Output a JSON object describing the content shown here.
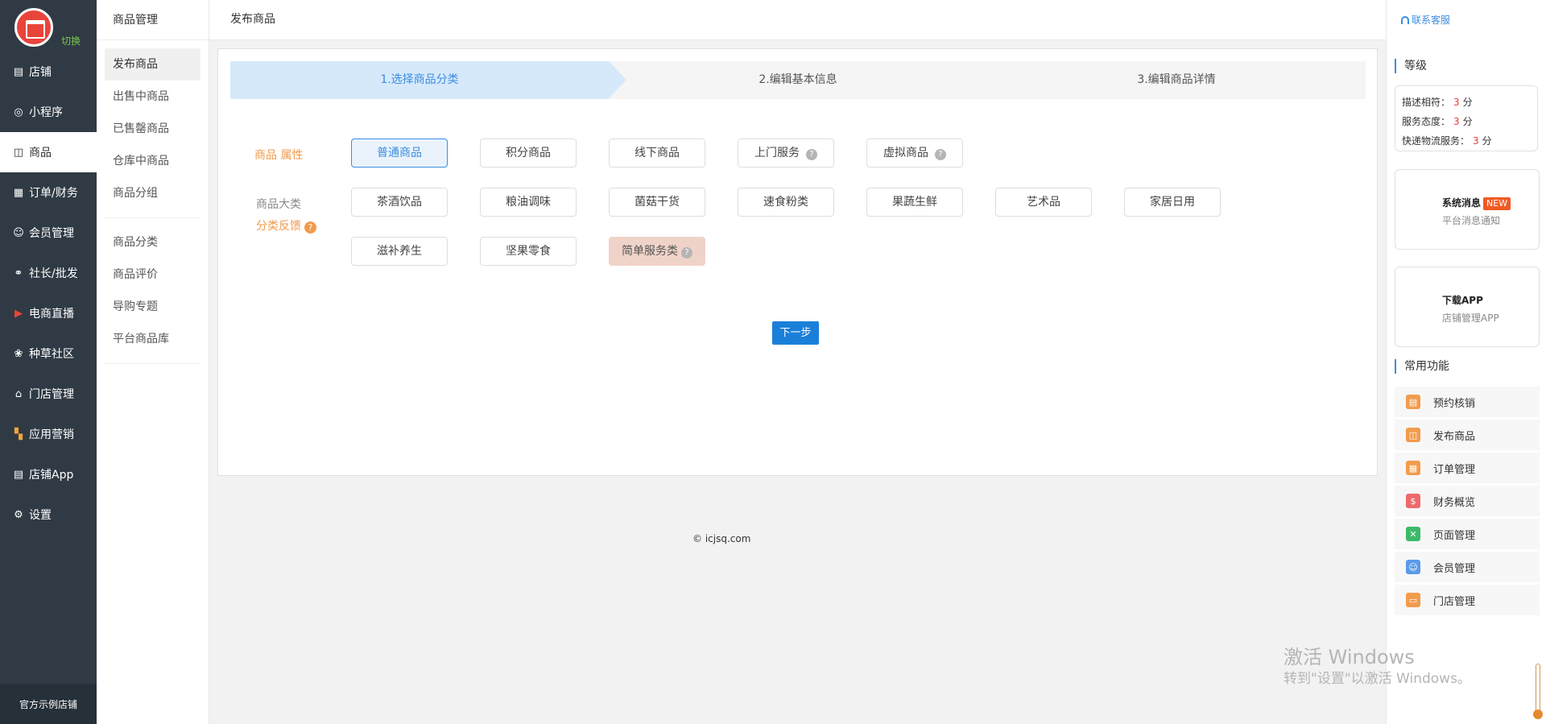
{
  "nav": {
    "switch_label": "切换",
    "items": [
      {
        "label": "店铺",
        "icon": "store-icon"
      },
      {
        "label": "小程序",
        "icon": "compass-icon"
      },
      {
        "label": "商品",
        "icon": "bag-icon"
      },
      {
        "label": "订单/财务",
        "icon": "order-icon"
      },
      {
        "label": "会员管理",
        "icon": "members-icon"
      },
      {
        "label": "社长/批发",
        "icon": "share-icon"
      },
      {
        "label": "电商直播",
        "icon": "live-icon"
      },
      {
        "label": "种草社区",
        "icon": "leaf-icon"
      },
      {
        "label": "门店管理",
        "icon": "house-icon"
      },
      {
        "label": "应用营销",
        "icon": "apps-icon"
      },
      {
        "label": "店铺App",
        "icon": "store-app-icon"
      },
      {
        "label": "设置",
        "icon": "gear-icon"
      }
    ],
    "footer": "官方示例店铺"
  },
  "subnav": {
    "title": "商品管理",
    "group1": [
      "发布商品",
      "出售中商品",
      "已售罄商品",
      "仓库中商品",
      "商品分组"
    ],
    "group2": [
      "商品分类",
      "商品评价",
      "导购专题",
      "平台商品库"
    ]
  },
  "topbar": {
    "title": "发布商品"
  },
  "steps": [
    "1.选择商品分类",
    "2.编辑基本信息",
    "3.编辑商品详情"
  ],
  "form": {
    "attr_label": "商品 属性",
    "cat_label": "商品大类",
    "feedback_label": "分类反馈",
    "feedback_help": "?",
    "attrs": [
      "普通商品",
      "积分商品",
      "线下商品",
      "上门服务",
      "虚拟商品"
    ],
    "help_mark": "?",
    "categories": [
      "茶酒饮品",
      "粮油调味",
      "菌菇干货",
      "速食粉类",
      "果蔬生鲜",
      "艺术品",
      "家居日用",
      "滋补养生",
      "坚果零食",
      "简单服务类"
    ],
    "next_label": "下一步"
  },
  "footer": {
    "copyright": "© icjsq.com"
  },
  "right": {
    "contact": "联系客服",
    "grade_title": "等级",
    "grades": [
      {
        "label": "描述相符：",
        "value": "3",
        "unit": "分"
      },
      {
        "label": "服务态度：",
        "value": "3",
        "unit": "分"
      },
      {
        "label": "快递物流服务：",
        "value": "3",
        "unit": "分"
      }
    ],
    "sys_msg_title": "系统消息",
    "new_badge": "NEW",
    "sys_msg_sub": "平台消息通知",
    "app_title": "下载APP",
    "app_sub": "店铺管理APP",
    "common_title": "常用功能",
    "functions": [
      {
        "label": "预约核销",
        "color": "#f29b4b"
      },
      {
        "label": "发布商品",
        "color": "#f29b4b"
      },
      {
        "label": "订单管理",
        "color": "#f29b4b"
      },
      {
        "label": "财务概览",
        "color": "#ee6a6a"
      },
      {
        "label": "页面管理",
        "color": "#3cb96a"
      },
      {
        "label": "会员管理",
        "color": "#5a9be8"
      },
      {
        "label": "门店管理",
        "color": "#f29b4b"
      }
    ]
  },
  "watermark": {
    "line1": "激活 Windows",
    "line2": "转到\"设置\"以激活 Windows。"
  }
}
